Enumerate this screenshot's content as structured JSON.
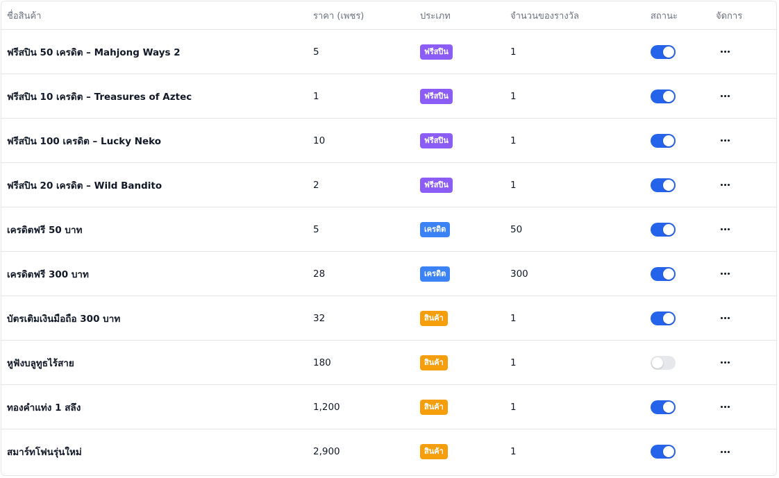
{
  "colors": {
    "freespin_badge": "#8b5cf6",
    "credit_badge": "#3b82f6",
    "item_badge": "#f59e0b",
    "toggle_on": "#2563eb",
    "toggle_off": "#e5e7eb"
  },
  "headers": {
    "name": "ชื่อสินค้า",
    "price": "ราคา (เพชร)",
    "type": "ประเภท",
    "reward": "จำนวนของรางวัล",
    "status": "สถานะ",
    "action": "จัดการ"
  },
  "rows": [
    {
      "name": "ฟรีสปิน 50 เครดิต – Mahjong Ways 2",
      "price": "5",
      "type": "ฟรีสปิน",
      "type_key": "freespin",
      "reward": "1",
      "active": true
    },
    {
      "name": "ฟรีสปิน 10 เครดิต – Treasures of Aztec",
      "price": "1",
      "type": "ฟรีสปิน",
      "type_key": "freespin",
      "reward": "1",
      "active": true
    },
    {
      "name": "ฟรีสปิน 100 เครดิต – Lucky Neko",
      "price": "10",
      "type": "ฟรีสปิน",
      "type_key": "freespin",
      "reward": "1",
      "active": true
    },
    {
      "name": "ฟรีสปิน 20 เครดิต – Wild Bandito",
      "price": "2",
      "type": "ฟรีสปิน",
      "type_key": "freespin",
      "reward": "1",
      "active": true
    },
    {
      "name": "เครดิตฟรี 50 บาท",
      "price": "5",
      "type": "เครดิต",
      "type_key": "credit",
      "reward": "50",
      "active": true
    },
    {
      "name": "เครดิตฟรี 300 บาท",
      "price": "28",
      "type": "เครดิต",
      "type_key": "credit",
      "reward": "300",
      "active": true
    },
    {
      "name": "บัตรเติมเงินมือถือ 300 บาท",
      "price": "32",
      "type": "สินค้า",
      "type_key": "item",
      "reward": "1",
      "active": true
    },
    {
      "name": "หูฟังบลูทูธไร้สาย",
      "price": "180",
      "type": "สินค้า",
      "type_key": "item",
      "reward": "1",
      "active": false
    },
    {
      "name": "ทองคำแท่ง 1 สลึง",
      "price": "1,200",
      "type": "สินค้า",
      "type_key": "item",
      "reward": "1",
      "active": true
    },
    {
      "name": "สมาร์ทโฟนรุ่นใหม่",
      "price": "2,900",
      "type": "สินค้า",
      "type_key": "item",
      "reward": "1",
      "active": true
    }
  ],
  "icons": {
    "more": "more-horizontal-icon"
  }
}
